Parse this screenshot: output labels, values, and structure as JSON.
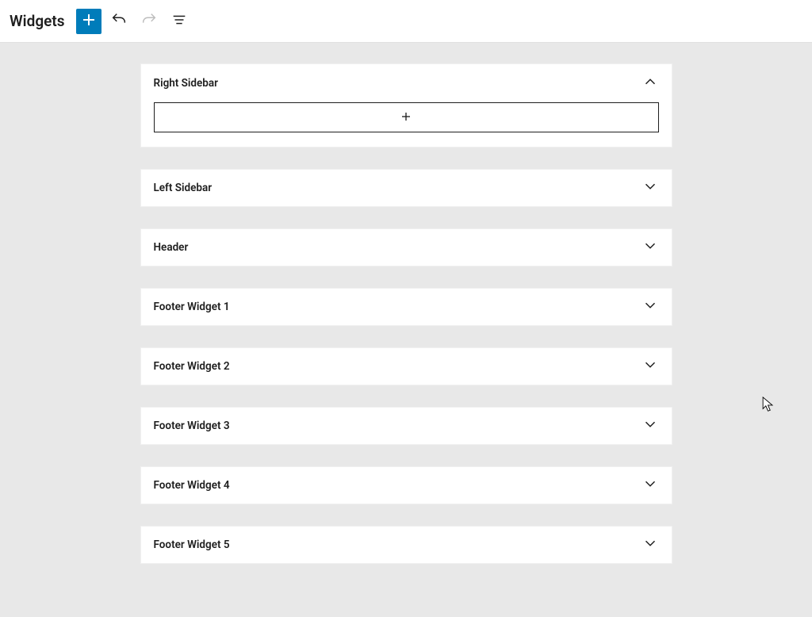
{
  "header": {
    "title": "Widgets"
  },
  "areas": [
    {
      "title": "Right Sidebar",
      "expanded": true
    },
    {
      "title": "Left Sidebar",
      "expanded": false
    },
    {
      "title": "Header",
      "expanded": false
    },
    {
      "title": "Footer Widget 1",
      "expanded": false
    },
    {
      "title": "Footer Widget 2",
      "expanded": false
    },
    {
      "title": "Footer Widget 3",
      "expanded": false
    },
    {
      "title": "Footer Widget 4",
      "expanded": false
    },
    {
      "title": "Footer Widget 5",
      "expanded": false
    }
  ]
}
